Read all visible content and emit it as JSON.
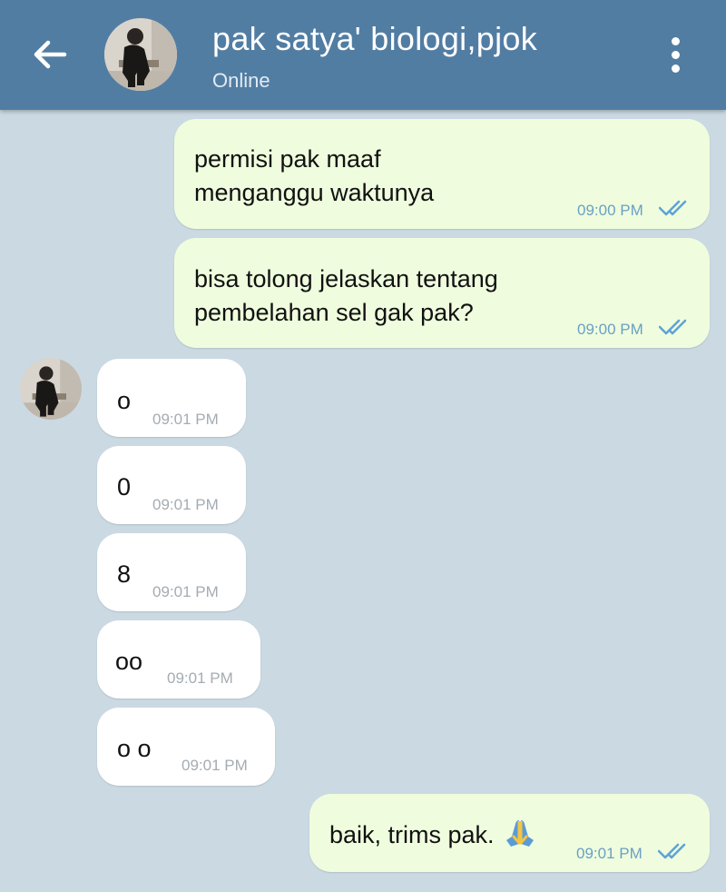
{
  "header": {
    "title": "pak satya' biologi,pjok",
    "status": "Online",
    "bg_color": "#527da3"
  },
  "icons": {
    "back": "arrow-left-icon",
    "menu": "more-vertical-icon",
    "read": "double-check-icon",
    "emoji": "folded-hands-emoji"
  },
  "messages": [
    {
      "dir": "out",
      "lines": [
        "permisi pak maaf",
        "menganggu waktunya"
      ],
      "time": "09:00 PM",
      "read": true
    },
    {
      "dir": "out",
      "lines": [
        "bisa tolong jelaskan tentang",
        "pembelahan sel gak pak?"
      ],
      "time": "09:00 PM",
      "read": true
    },
    {
      "dir": "in",
      "text": "o",
      "time": "09:01 PM"
    },
    {
      "dir": "in",
      "text": "0",
      "time": "09:01 PM"
    },
    {
      "dir": "in",
      "text": "8",
      "time": "09:01 PM"
    },
    {
      "dir": "in",
      "text": "oo",
      "time": "09:01 PM"
    },
    {
      "dir": "in",
      "text": "o o",
      "time": "09:01 PM"
    },
    {
      "dir": "out",
      "text": "baik, trims pak.",
      "emoji": "🙏",
      "time": "09:01 PM",
      "read": true
    }
  ],
  "colors": {
    "chat_bg": "#cbd9e3",
    "outgoing_bubble": "#effdde",
    "incoming_bubble": "#ffffff",
    "check": "#5fa3d6"
  }
}
